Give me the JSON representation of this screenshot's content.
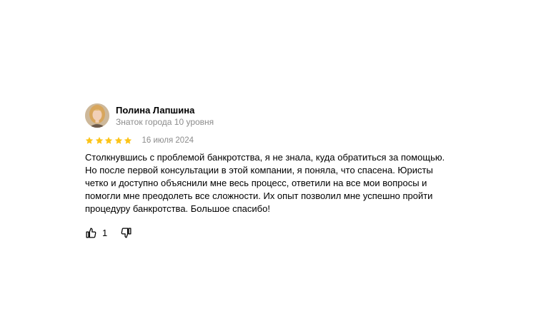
{
  "review": {
    "author": {
      "name": "Полина Лапшина",
      "level": "Знаток города 10 уровня",
      "avatar_icon": "user-photo"
    },
    "rating": 5,
    "rating_max": 5,
    "star_color": "#fcc418",
    "date": "16 июля 2024",
    "text": "Столкнувшись с проблемой банкротства, я не знала, куда обратиться за помощью. Но после первой консультации в этой компании, я поняла, что спасена. Юристы четко и доступно объяснили мне весь процесс, ответили на все мои вопросы и помогли мне преодолеть все сложности. Их опыт позволил мне успешно пройти процедуру банкротства. Большое спасибо!",
    "reactions": {
      "like_icon": "thumbs-up-icon",
      "like_count": "1",
      "dislike_icon": "thumbs-down-icon"
    }
  }
}
